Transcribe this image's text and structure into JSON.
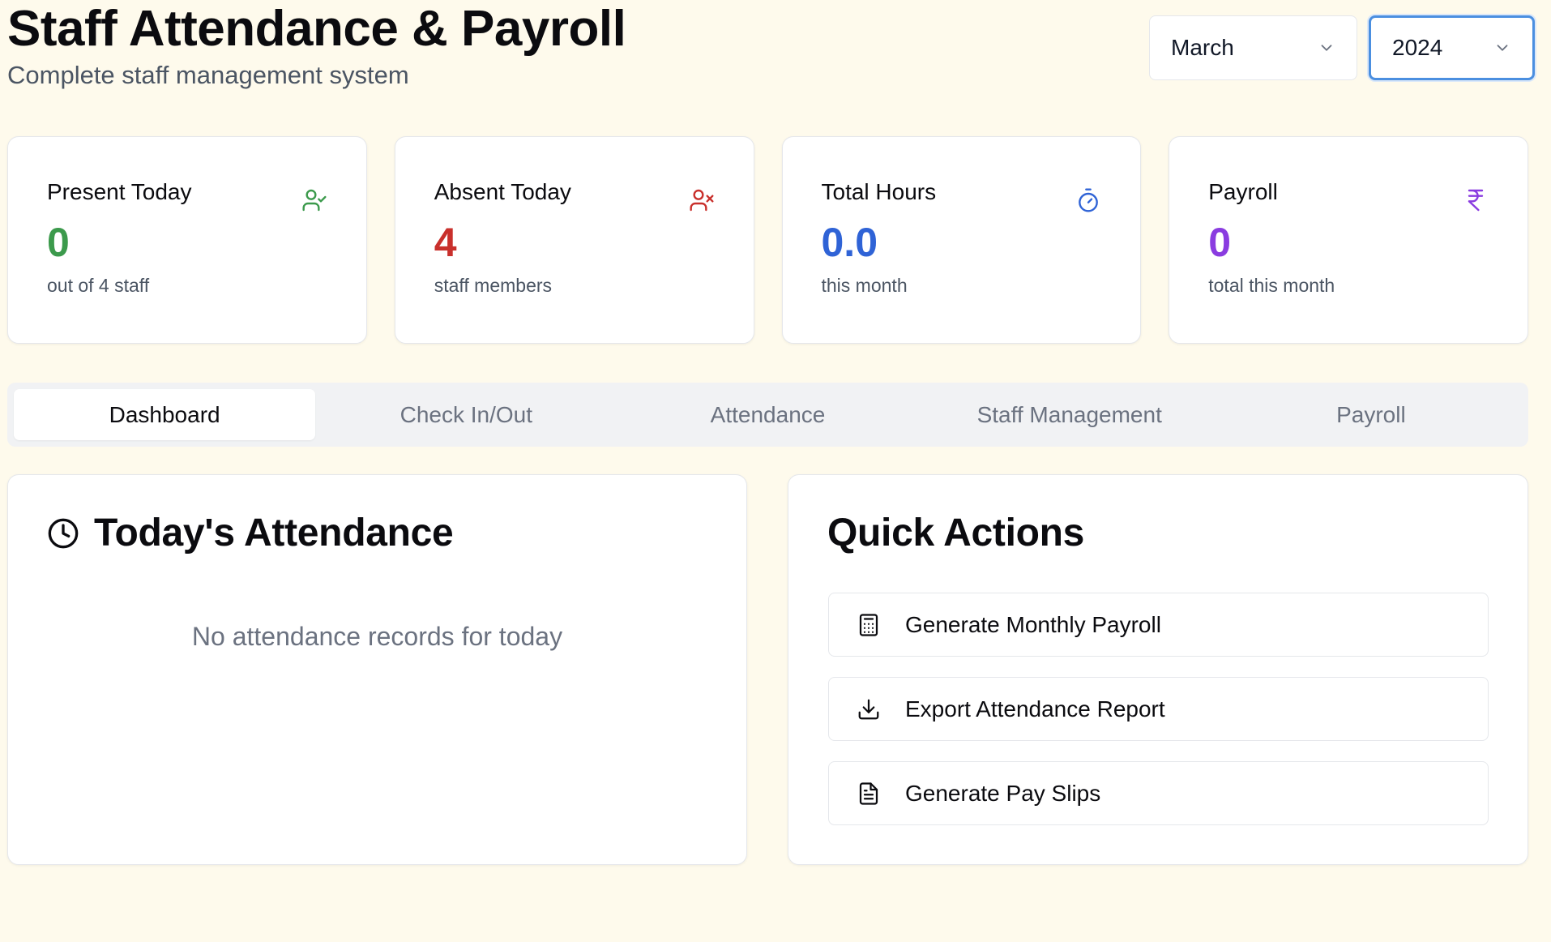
{
  "header": {
    "title": "Staff Attendance & Payroll",
    "subtitle": "Complete staff management system"
  },
  "filters": {
    "month": "March",
    "year": "2024"
  },
  "stats": [
    {
      "title": "Present Today",
      "value": "0",
      "sub": "out of 4 staff",
      "icon": "user-check-icon",
      "color": "#3c9a4c"
    },
    {
      "title": "Absent Today",
      "value": "4",
      "sub": "staff members",
      "icon": "user-x-icon",
      "color": "#c9302c"
    },
    {
      "title": "Total Hours",
      "value": "0.0",
      "sub": "this month",
      "icon": "timer-icon",
      "color": "#2f63d6"
    },
    {
      "title": "Payroll",
      "value": "0",
      "sub": "total this month",
      "icon": "rupee-icon",
      "color": "#8a3ce0"
    }
  ],
  "tabs": [
    {
      "label": "Dashboard",
      "active": true
    },
    {
      "label": "Check In/Out",
      "active": false
    },
    {
      "label": "Attendance",
      "active": false
    },
    {
      "label": "Staff Management",
      "active": false
    },
    {
      "label": "Payroll",
      "active": false
    }
  ],
  "attendance_panel": {
    "title": "Today's Attendance",
    "empty_message": "No attendance records for today",
    "icon": "clock-icon"
  },
  "quick_actions": {
    "title": "Quick Actions",
    "items": [
      {
        "label": "Generate Monthly Payroll",
        "icon": "calculator-icon"
      },
      {
        "label": "Export Attendance Report",
        "icon": "download-icon"
      },
      {
        "label": "Generate Pay Slips",
        "icon": "file-text-icon"
      }
    ]
  }
}
